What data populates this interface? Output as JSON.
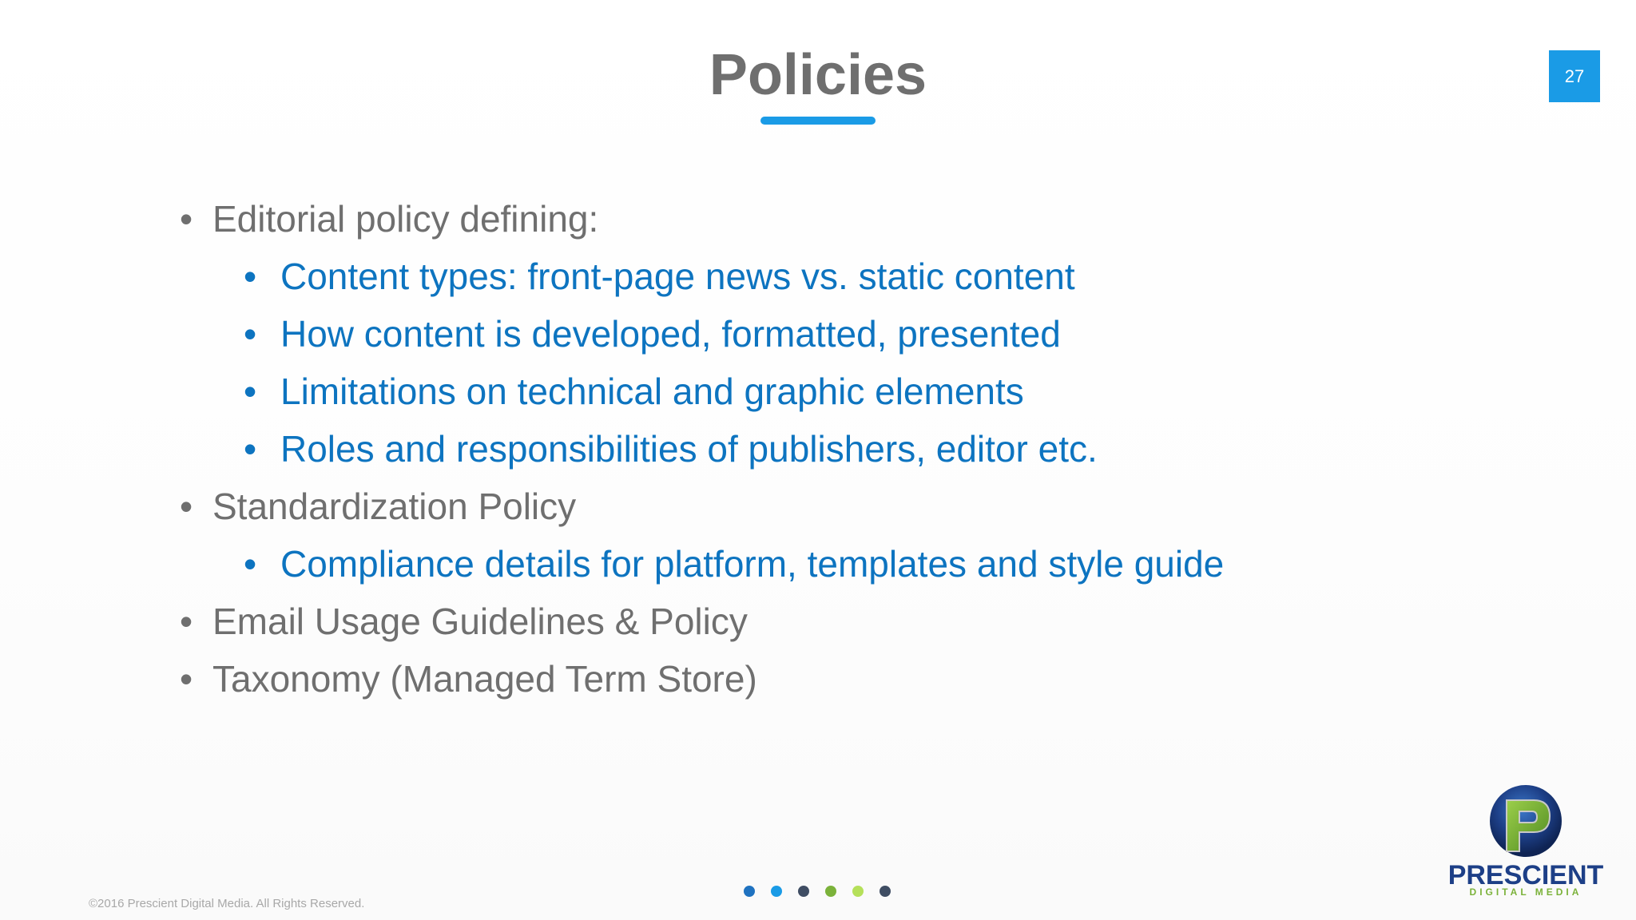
{
  "slide": {
    "title": "Policies",
    "page_number": "27",
    "accent_color": "#1a9be6"
  },
  "bullets": [
    {
      "level": 1,
      "text": "Editorial policy defining:"
    },
    {
      "level": 2,
      "text": "Content types: front-page news vs. static content"
    },
    {
      "level": 2,
      "text": "How content is developed, formatted, presented"
    },
    {
      "level": 2,
      "text": "Limitations on technical and graphic elements"
    },
    {
      "level": 2,
      "text": "Roles and responsibilities of publishers, editor etc."
    },
    {
      "level": 1,
      "text": "Standardization Policy"
    },
    {
      "level": 2,
      "text": "Compliance details for platform, templates and style guide"
    },
    {
      "level": 1,
      "text": "Email Usage Guidelines & Policy"
    },
    {
      "level": 1,
      "text": "Taxonomy (Managed Term Store)"
    }
  ],
  "bullet_glyph": "•",
  "footer": {
    "copyright": "©2016 Prescient Digital Media. All Rights Reserved."
  },
  "dots": {
    "colors": [
      "#1f72c0",
      "#1a9be6",
      "#3f4d63",
      "#7bb23a",
      "#b5e05a",
      "#3f4d63"
    ]
  },
  "logo": {
    "icon": "prescient-p-globe-logo",
    "name": "PRESCIENT",
    "tagline": "DIGITAL MEDIA"
  }
}
